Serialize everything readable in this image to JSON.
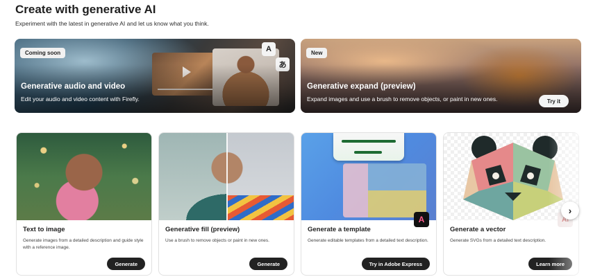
{
  "header": {
    "title": "Create with generative AI",
    "subtitle": "Experiment with the latest in generative AI and let us know what you think."
  },
  "banners": [
    {
      "badge": "Coming soon",
      "title": "Generative audio and video",
      "description": "Edit your audio and video content with Firefly.",
      "chips": [
        "A",
        "あ"
      ]
    },
    {
      "badge": "New",
      "title": "Generative expand (preview)",
      "description": "Expand images and use a brush to remove objects, or paint in new ones.",
      "button": "Try it"
    }
  ],
  "cards": [
    {
      "title": "Text to image",
      "description": "Generate images from a detailed description and guide style with a reference image.",
      "button": "Generate"
    },
    {
      "title": "Generative fill (preview)",
      "description": "Use a brush to remove objects or paint in new ones.",
      "button": "Generate"
    },
    {
      "title": "Generate a template",
      "description": "Generate editable templates from a detailed text description.",
      "button": "Try in Adobe Express"
    },
    {
      "title": "Generate a vector",
      "description": "Generate SVGs from a detailed text description.",
      "button": "Learn more"
    }
  ],
  "carousel": {
    "next_icon": "›"
  },
  "icons": {
    "play": "play-icon",
    "adobe_express": "adobe-express-icon",
    "vector_app": "vector-app-icon",
    "chevron_right": "chevron-right-icon"
  },
  "colors": {
    "primary_button": "#222222",
    "badge_bg": "#f1f1f1"
  }
}
